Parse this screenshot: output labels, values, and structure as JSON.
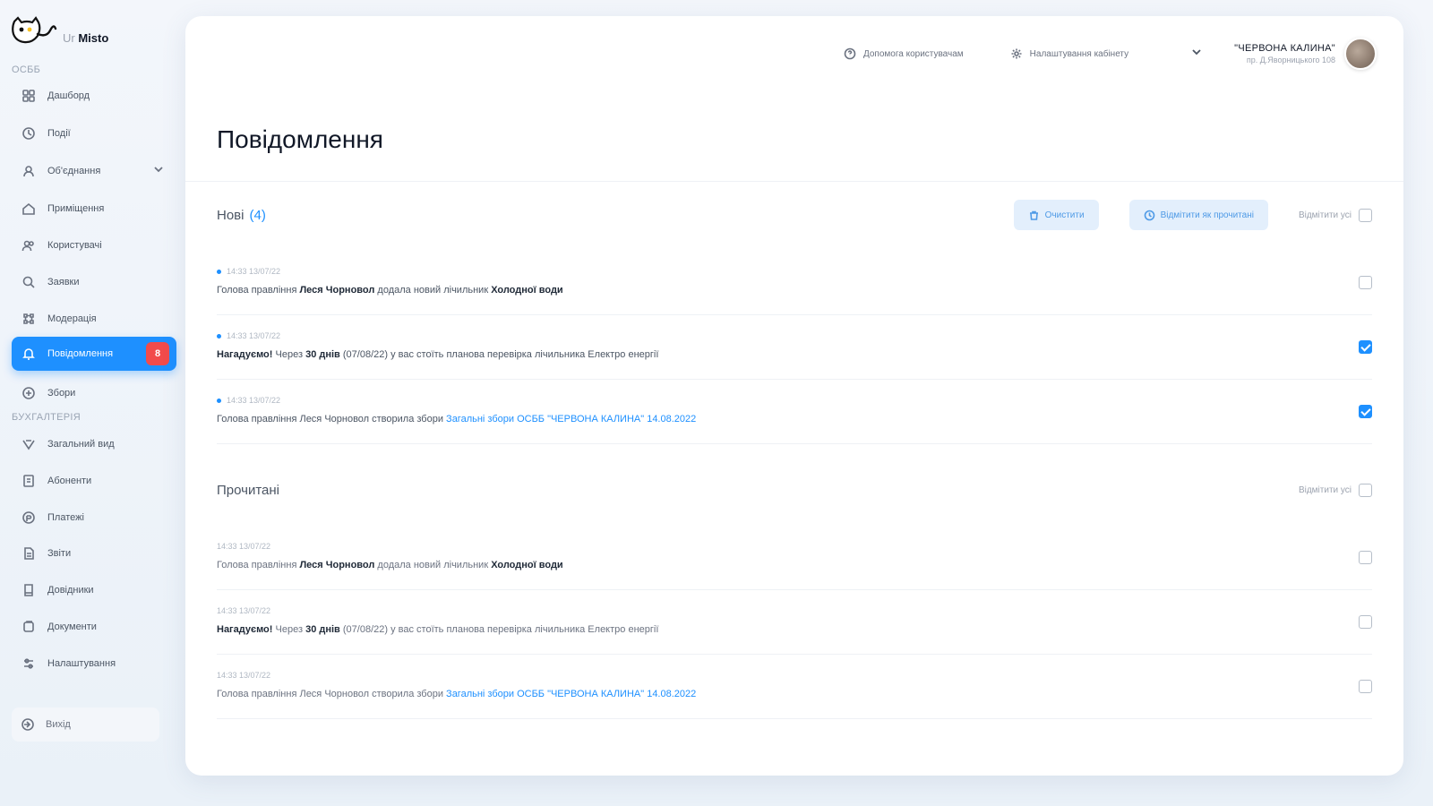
{
  "app": {
    "logo_prefix": "Ur",
    "logo_name": "Misto"
  },
  "sidebar": {
    "section_osbb": "ОСББ",
    "section_buh": "БУХГАЛТЕРІЯ",
    "items": [
      {
        "label": "Дашборд",
        "icon": "dashboard-icon"
      },
      {
        "label": "Події",
        "icon": "events-icon"
      },
      {
        "label": "Об'єднання",
        "icon": "union-icon"
      },
      {
        "label": "Приміщення",
        "icon": "home-icon"
      },
      {
        "label": "Користувачі",
        "icon": "users-icon"
      },
      {
        "label": "Заявки",
        "icon": "requests-icon"
      },
      {
        "label": "Модерація",
        "icon": "moderation-icon"
      },
      {
        "label": "Повідомлення",
        "icon": "bell-icon",
        "badge": "8"
      },
      {
        "label": "Збори",
        "icon": "meetings-icon"
      }
    ],
    "buh_items": [
      {
        "label": "Загальний вид",
        "icon": "overview-icon"
      },
      {
        "label": "Абоненти",
        "icon": "subscribers-icon"
      },
      {
        "label": "Платежі",
        "icon": "payments-icon"
      },
      {
        "label": "Звіти",
        "icon": "reports-icon"
      },
      {
        "label": "Довідники",
        "icon": "reference-icon"
      },
      {
        "label": "Документи",
        "icon": "documents-icon"
      },
      {
        "label": "Налаштування",
        "icon": "settings-icon"
      }
    ],
    "logout": "Вихід"
  },
  "header": {
    "help": "Допомога користувачам",
    "settings": "Налаштування кабінету",
    "user_name": "\"ЧЕРВОНА КАЛИНА\"",
    "user_sub": "пр. Д.Яворницького 108"
  },
  "page": {
    "title": "Повідомлення"
  },
  "new_group": {
    "title": "Нові",
    "count": "(4)",
    "clear_label": "Очистити",
    "mark_read_label": "Відмітити як прочитані",
    "mark_all_label": "Відмітити усі",
    "items": [
      {
        "time": "14:33 13/07/22",
        "pre": "Голова правління",
        "strong1": "Леся Чорновол",
        "mid": "додала новий лічильник",
        "strong2": "Холодної води",
        "post": "",
        "link": "",
        "checked": false
      },
      {
        "time": "14:33 13/07/22",
        "pre": "",
        "strong1": "Нагадуємо!",
        "mid": "Через",
        "strong2": "30 днів",
        "post": "(07/08/22) у вас стоїть планова перевірка лічильника Електро енергії",
        "link": "",
        "checked": true
      },
      {
        "time": "14:33 13/07/22",
        "pre": "Голова правління",
        "strong1": "",
        "mid": "Леся Чорновол створила збори",
        "strong2": "",
        "post": "",
        "link": "Загальні збори ОСББ \"ЧЕРВОНА КАЛИНА\" 14.08.2022",
        "checked": true
      }
    ]
  },
  "read_group": {
    "title": "Прочитані",
    "mark_all_label": "Відмітити усі",
    "items": [
      {
        "time": "14:33 13/07/22",
        "pre": "Голова правління",
        "strong1": "Леся Чорновол",
        "mid": "додала новий лічильник",
        "strong2": "Холодної води",
        "post": "",
        "link": "",
        "checked": false
      },
      {
        "time": "14:33 13/07/22",
        "pre": "",
        "strong1": "Нагадуємо!",
        "mid": "Через",
        "strong2": "30 днів",
        "post": "(07/08/22) у вас стоїть планова перевірка лічильника Електро енергії",
        "link": "",
        "checked": false
      },
      {
        "time": "14:33 13/07/22",
        "pre": "Голова правління",
        "strong1": "",
        "mid": "Леся Чорновол створила збори",
        "strong2": "",
        "post": "",
        "link": "Загальні збори ОСББ \"ЧЕРВОНА КАЛИНА\" 14.08.2022",
        "checked": false
      }
    ]
  }
}
